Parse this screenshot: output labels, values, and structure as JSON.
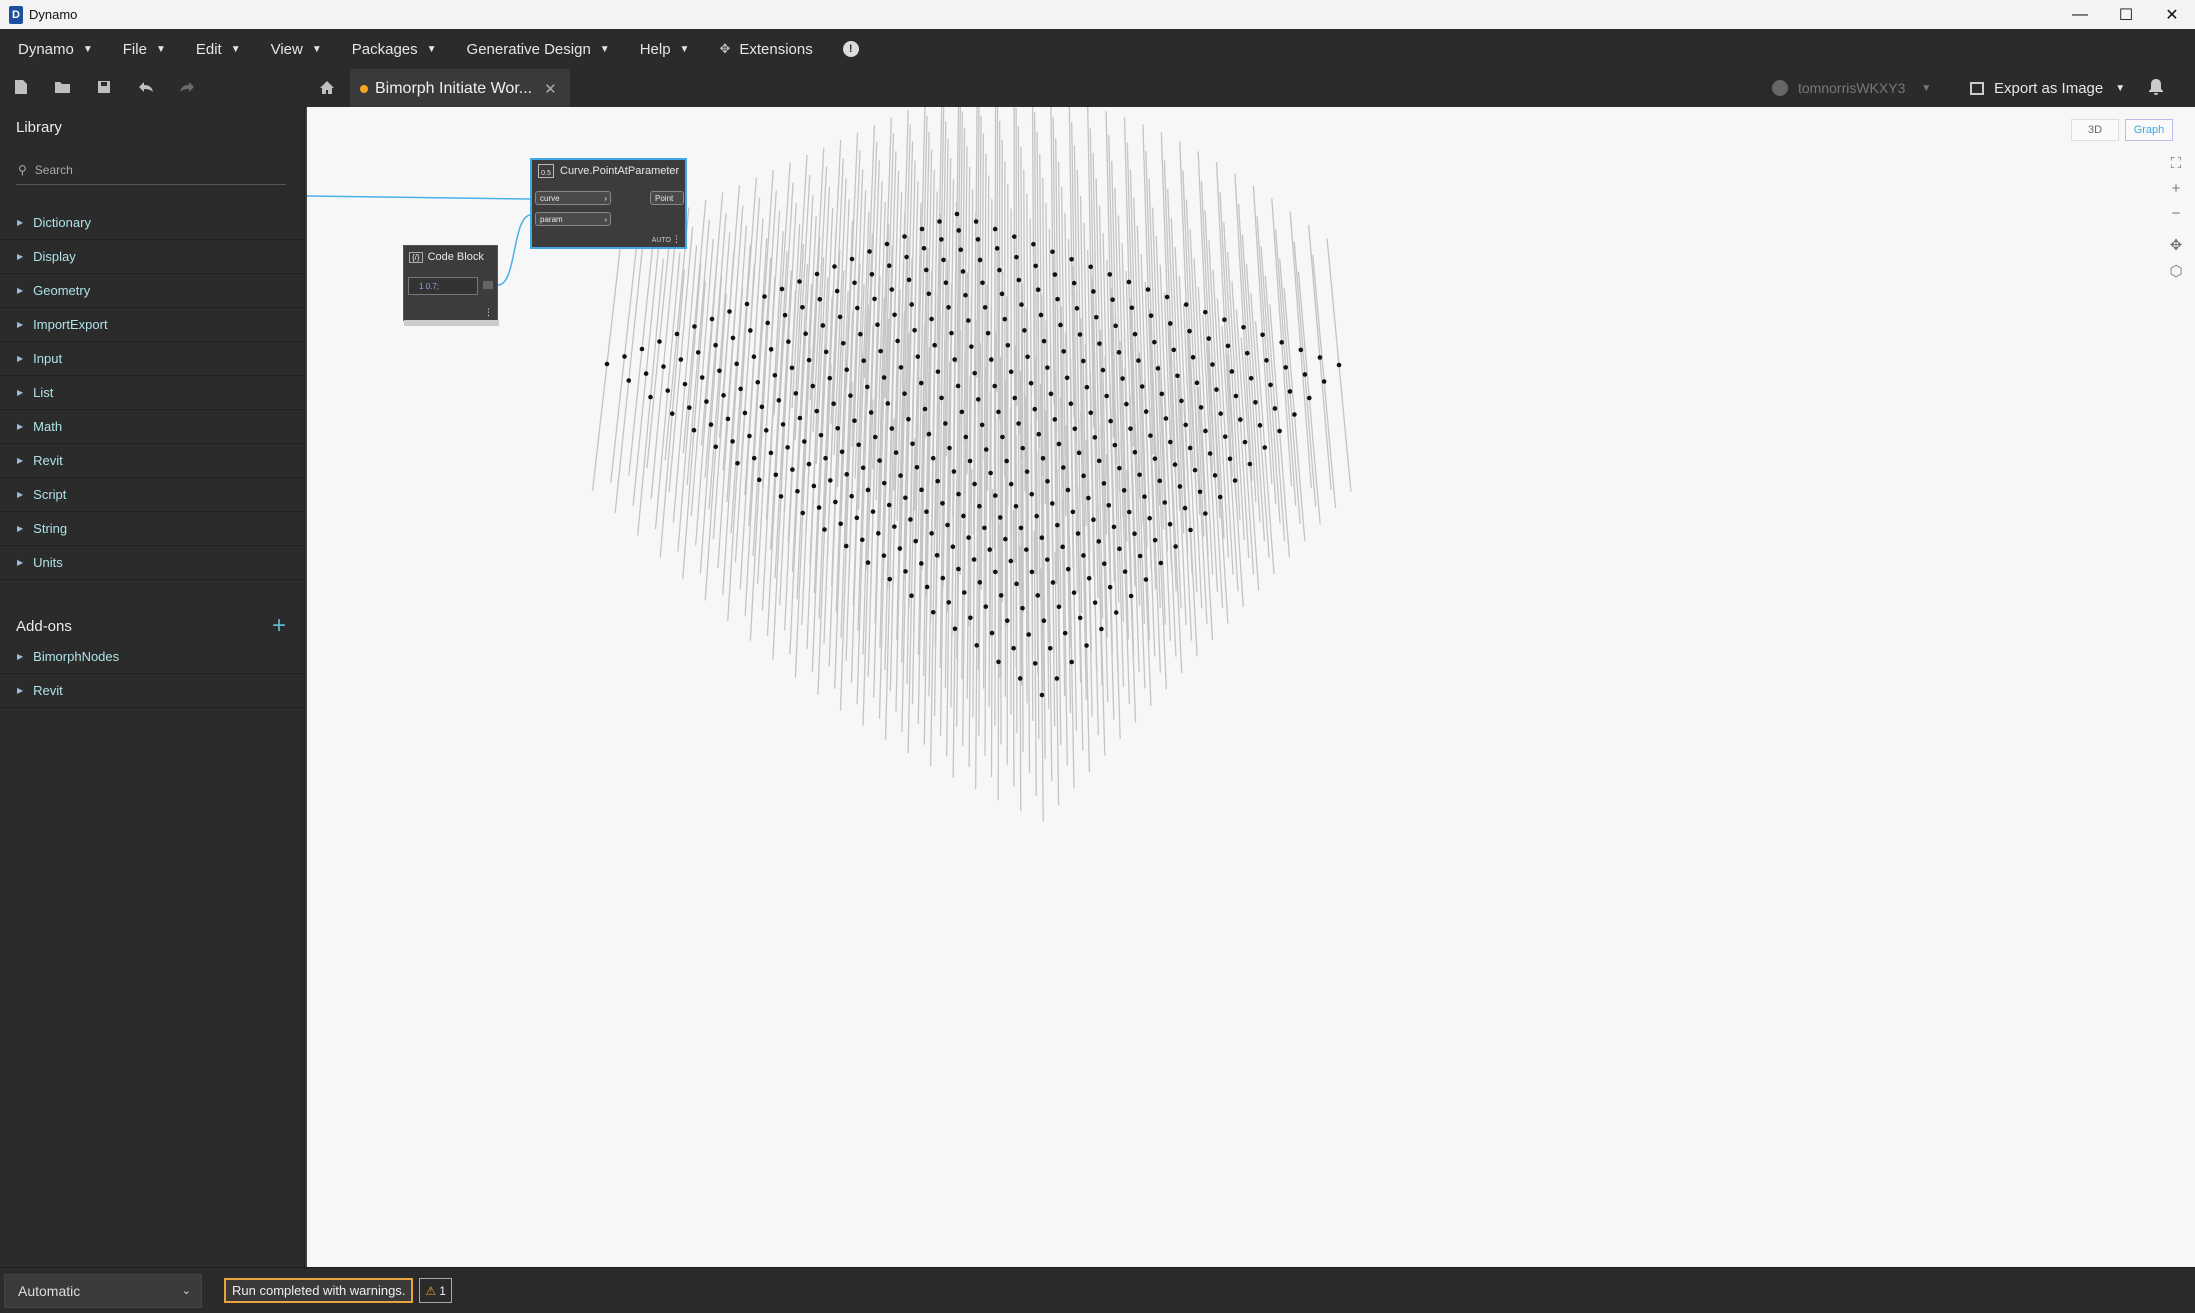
{
  "window": {
    "title": "Dynamo",
    "app_icon_letter": "D",
    "minimize": "—",
    "maximize": "☐",
    "close": "✕"
  },
  "menubar": {
    "items": [
      {
        "label": "Dynamo"
      },
      {
        "label": "File"
      },
      {
        "label": "Edit"
      },
      {
        "label": "View"
      },
      {
        "label": "Packages"
      },
      {
        "label": "Generative Design"
      },
      {
        "label": "Help"
      }
    ],
    "extensions_label": "Extensions",
    "info": "!"
  },
  "toolbar": {
    "tab_title": "Bimorph Initiate Wor...",
    "tab_close": "✕",
    "user_name": "tomnorrisWKXY3",
    "export_label": "Export as Image"
  },
  "library": {
    "title": "Library",
    "search_placeholder": "Search",
    "categories": [
      "Dictionary",
      "Display",
      "Geometry",
      "ImportExport",
      "Input",
      "List",
      "Math",
      "Revit",
      "Script",
      "String",
      "Units"
    ],
    "addons_title": "Add-ons",
    "addons_plus": "+",
    "addons": [
      "BimorphNodes",
      "Revit"
    ]
  },
  "nodes": {
    "curve_point": {
      "title": "Curve.PointAtParameter",
      "icon_text": "0.5",
      "input_1": "curve",
      "input_2": "param",
      "output": "Point",
      "lacing": "AUTO"
    },
    "code_block": {
      "title": "Code Block",
      "code": "1  0.7;"
    }
  },
  "canvas_controls": {
    "view_3d": "3D",
    "view_graph": "Graph"
  },
  "statusbar": {
    "run_mode": "Automatic",
    "run_status": "Run completed with warnings.",
    "warning_count": "1",
    "warning_icon": "⚠"
  },
  "colors": {
    "accent": "#3ea9e6",
    "warning": "#e8a33d",
    "tab_dot": "#f5a623"
  }
}
